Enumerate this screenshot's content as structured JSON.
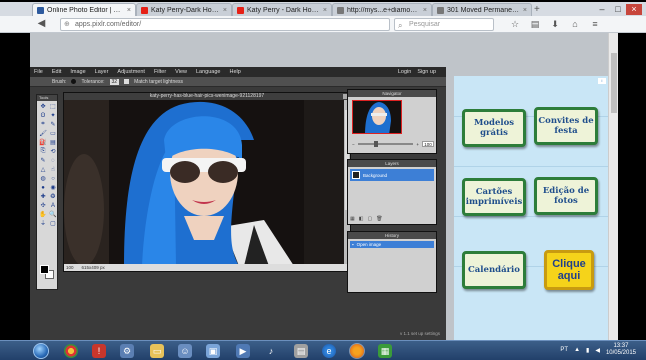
{
  "browser": {
    "tabs": [
      {
        "label": "Online Photo Editor | Pi...",
        "active": true,
        "favicon_color": "#2e5a9e"
      },
      {
        "label": "Katy Perry-Dark Horse...",
        "active": false,
        "favicon_color": "#e62117"
      },
      {
        "label": "Katy Perry - Dark Horse...",
        "active": false,
        "favicon_color": "#e62117"
      },
      {
        "label": "http://mys...e+diamonds",
        "active": false,
        "favicon_color": "#777777"
      },
      {
        "label": "301 Moved Permanently",
        "active": false,
        "favicon_color": "#777777"
      }
    ],
    "new_tab": "+",
    "window_controls": {
      "minimize": "–",
      "maximize": "□",
      "close": "×"
    },
    "url": "apps.pixlr.com/editor/",
    "search_placeholder": "Pesquisar"
  },
  "pixlr": {
    "menu": [
      "File",
      "Edit",
      "Image",
      "Layer",
      "Adjustment",
      "Filter",
      "View",
      "Language",
      "Help"
    ],
    "account": [
      "Login",
      "Sign up"
    ],
    "options": {
      "brush_label": "Brush:",
      "tolerance_label": "Tolerance:",
      "tolerance_value": "32",
      "match_label": "Match target lightness"
    },
    "tools_title": "Tools",
    "tool_icons": [
      "move-icon",
      "marquee-icon",
      "lasso-icon",
      "wand-icon",
      "crop-icon",
      "pencil-icon",
      "brush-icon",
      "eraser-icon",
      "bucket-icon",
      "gradient-icon",
      "clone-icon",
      "color-replace-icon",
      "drawing-icon",
      "blur-icon",
      "sharpen-icon",
      "smudge-icon",
      "sponge-icon",
      "dodge-icon",
      "burn-icon",
      "redeye-icon",
      "spot-heal-icon",
      "bloat-icon",
      "pinch-icon",
      "type-icon",
      "hand-icon",
      "zoom-icon",
      "eyedropper-icon",
      "shape-icon"
    ],
    "tool_glyphs": [
      "✥",
      "⬚",
      "ʘ",
      "✦",
      "⌗",
      "✎",
      "🖌",
      "▭",
      "⛽",
      "▤",
      "⎘",
      "⟲",
      "✎",
      "◌",
      "△",
      "☝",
      "◍",
      "○",
      "●",
      "◉",
      "✚",
      "❂",
      "✣",
      "A",
      "✋",
      "🔍",
      "⍊",
      "▢"
    ],
    "image_title": "katy-perry-has-blue-hair-pics-wenimage-921128197",
    "zoom": "100",
    "dims": "615x409 px",
    "navigator_title": "Navigator",
    "navigator_zoom": "100",
    "layers_title": "Layers",
    "layer_name": "Background",
    "history_title": "History",
    "history_item": "Open image",
    "footer": "v 1.1   set up settings"
  },
  "ad": {
    "buttons": [
      "Modelos grátis",
      "Convites de festa",
      "Cartões imprimíveis",
      "Edição de fotos",
      "Calendário",
      "Clique aqui"
    ],
    "info": "i"
  },
  "taskbar": {
    "lang": "PT",
    "time": "13:37",
    "date": "10/05/2015"
  }
}
